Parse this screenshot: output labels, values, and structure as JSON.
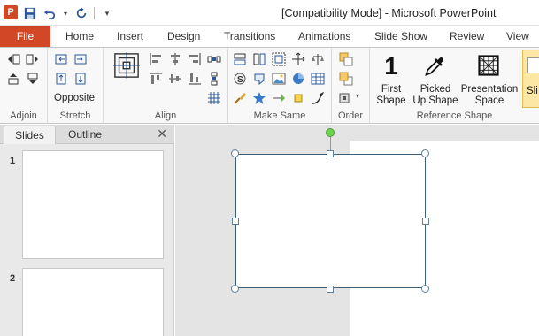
{
  "window": {
    "title": "[Compatibility Mode]  -  Microsoft PowerPoint",
    "app_icon": "P"
  },
  "quick_access": {
    "save_icon": "save-icon",
    "undo_icon": "undo-icon",
    "redo_icon": "repeat-icon",
    "customize_icon": "customize-qat-icon"
  },
  "tabs": {
    "file": "File",
    "items": [
      "Home",
      "Insert",
      "Design",
      "Transitions",
      "Animations",
      "Slide Show",
      "Review",
      "View"
    ]
  },
  "ribbon": {
    "groups": {
      "adjoin": "Adjoin",
      "stretch": "Stretch",
      "align": "Align",
      "make_same": "Make Same",
      "order": "Order",
      "reference_shape": "Reference Shape"
    },
    "stretch_opposite": "Opposite",
    "reference": {
      "first_shape_line1": "First",
      "first_shape_line2": "Shape",
      "picked_line1": "Picked",
      "picked_line2": "Up Shape",
      "presentation_line1": "Presentation",
      "presentation_line2": "Space",
      "slide_partial": "Sli"
    },
    "first_shape_glyph": "1"
  },
  "left_panel": {
    "tab_slides": "Slides",
    "tab_outline": "Outline",
    "close_glyph": "✕",
    "slides": [
      {
        "number": "1"
      },
      {
        "number": "2"
      }
    ]
  },
  "colors": {
    "file_tab": "#d24726",
    "accent_blue": "#2b579a",
    "rotate_handle": "#6fd14f"
  }
}
